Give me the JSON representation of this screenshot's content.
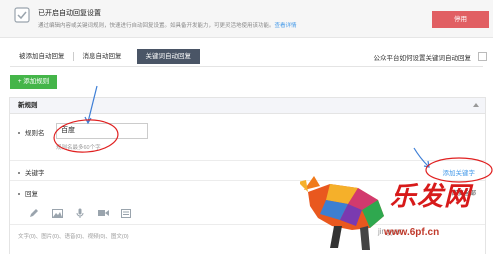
{
  "notice": {
    "title": "已开启自动回复设置",
    "desc": "通过编辑内容或关键词规则，快速进行自动回复设置。如具备开发能力，可更灵活地使用该功能。",
    "detail_link": "查看详情",
    "disable_label": "停用"
  },
  "tabs": [
    {
      "label": "被添加自动回复"
    },
    {
      "label": "消息自动回复"
    },
    {
      "label": "关键词自动回复"
    }
  ],
  "help_link": "公众平台如何设置关键词自动回复",
  "add_rule_label": "+ 添加规则",
  "panel": {
    "title": "新规则",
    "rule_name_label": "规则名",
    "rule_name_value": "百度",
    "rule_name_hint": "规则名最多60个字",
    "keyword_label": "关键字",
    "add_keyword_label": "添加关键字",
    "reply_label": "回复",
    "reply_all_label": "回复全部",
    "counts": "文字(0)、图片(0)、语音(0)、视频(0)、图文(0)"
  },
  "toolbar_icons": [
    "pen-icon",
    "image-icon",
    "microphone-icon",
    "video-icon",
    "article-icon"
  ],
  "watermark": {
    "text": "乐发网",
    "url": "www.6pf.cn",
    "jiyan": "jingyan"
  },
  "colors": {
    "disable": "#e15f63",
    "accent_green": "#44b549",
    "link_blue": "#459ae9",
    "active_tab": "#4a5566",
    "annotation_red": "#e02020",
    "arrow_blue": "#3f7fd6"
  }
}
